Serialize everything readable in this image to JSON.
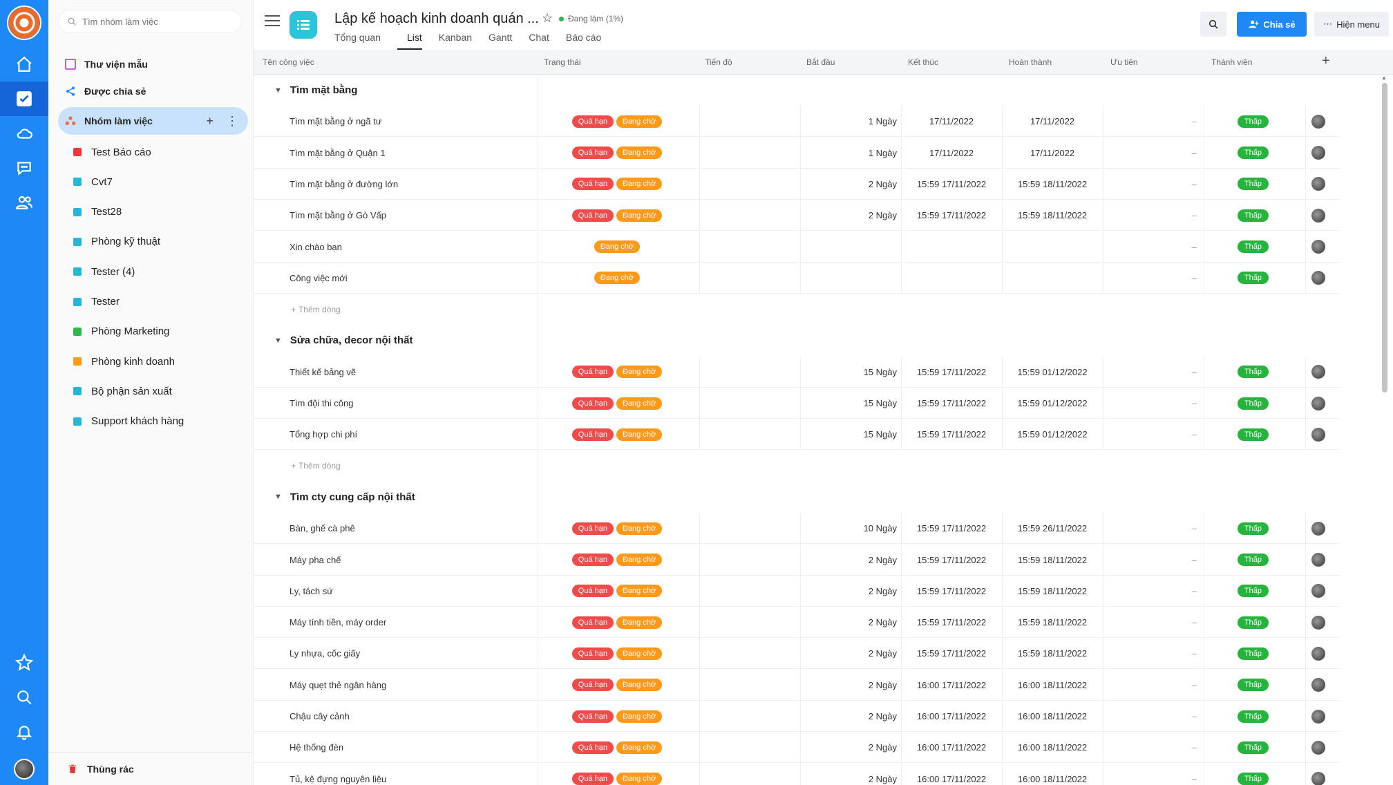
{
  "sidebar": {
    "search_placeholder": "Tìm nhóm làm việc",
    "library": "Thư viện mẫu",
    "shared": "Được chia sẻ",
    "workgroups": "Nhóm làm việc",
    "groups": [
      {
        "label": "Test Báo cáo",
        "color": "#f03a3a"
      },
      {
        "label": "Cvt7",
        "color": "#26b6d8"
      },
      {
        "label": "Test28",
        "color": "#26b6d8"
      },
      {
        "label": "Phòng kỹ thuật",
        "color": "#26b6d8"
      },
      {
        "label": "Tester (4)",
        "color": "#26b6d8"
      },
      {
        "label": "Tester",
        "color": "#26b6d8"
      },
      {
        "label": "Phòng Marketing",
        "color": "#2db84b"
      },
      {
        "label": "Phòng kinh doanh",
        "color": "#fd9a1a"
      },
      {
        "label": "Bộ phận sản xuất",
        "color": "#26b6d8"
      },
      {
        "label": "Support khách hàng",
        "color": "#26b6d8"
      }
    ],
    "trash": "Thùng rác"
  },
  "header": {
    "title": "Lập kế hoạch kinh doanh quán ...",
    "status": "Đang làm (1%)",
    "tabs": [
      "Tổng quan",
      "List",
      "Kanban",
      "Gantt",
      "Chat",
      "Báo cáo"
    ],
    "active_tab": "List",
    "share_label": "Chia sẻ",
    "menu_label": "Hiện menu"
  },
  "columns": [
    "Tên công việc",
    "Trạng thái",
    "Tiến độ",
    "Bắt đầu",
    "Kết thúc",
    "Hoàn thành",
    "Ưu tiên",
    "Thành viên"
  ],
  "add_row_label": "Thêm dòng",
  "groups": [
    {
      "name": "Tìm mặt bằng",
      "tasks": [
        {
          "name": "Tìm mặt bằng ở ngã tư",
          "overdue": "Quá hạn",
          "status": "Đang chờ",
          "duration": "1 Ngày",
          "start": "17/11/2022",
          "end": "17/11/2022",
          "done": "–",
          "priority": "Thấp"
        },
        {
          "name": "Tìm mặt bằng ở Quận 1",
          "overdue": "Quá hạn",
          "status": "Đang chờ",
          "duration": "1 Ngày",
          "start": "17/11/2022",
          "end": "17/11/2022",
          "done": "–",
          "priority": "Thấp"
        },
        {
          "name": "Tìm mặt bằng ở đường lớn",
          "overdue": "Quá hạn",
          "status": "Đang chờ",
          "duration": "2 Ngày",
          "start": "15:59 17/11/2022",
          "end": "15:59 18/11/2022",
          "done": "–",
          "priority": "Thấp"
        },
        {
          "name": "Tìm mặt bằng ở Gò Vấp",
          "overdue": "Quá hạn",
          "status": "Đang chờ",
          "duration": "2 Ngày",
          "start": "15:59 17/11/2022",
          "end": "15:59 18/11/2022",
          "done": "–",
          "priority": "Thấp"
        },
        {
          "name": "Xin chào bạn",
          "overdue": "",
          "status": "Đang chờ",
          "duration": "",
          "start": "",
          "end": "",
          "done": "–",
          "priority": "Thấp"
        },
        {
          "name": "Công việc mới",
          "overdue": "",
          "status": "Đang chờ",
          "duration": "",
          "start": "",
          "end": "",
          "done": "–",
          "priority": "Thấp"
        }
      ]
    },
    {
      "name": "Sửa chữa, decor nội thất",
      "tasks": [
        {
          "name": "Thiết kế bảng vẽ",
          "overdue": "Quá hạn",
          "status": "Đang chờ",
          "duration": "15 Ngày",
          "start": "15:59 17/11/2022",
          "end": "15:59 01/12/2022",
          "done": "–",
          "priority": "Thấp"
        },
        {
          "name": "Tìm đội thi công",
          "overdue": "Quá hạn",
          "status": "Đang chờ",
          "duration": "15 Ngày",
          "start": "15:59 17/11/2022",
          "end": "15:59 01/12/2022",
          "done": "–",
          "priority": "Thấp"
        },
        {
          "name": "Tổng hợp chi phí",
          "overdue": "Quá hạn",
          "status": "Đang chờ",
          "duration": "15 Ngày",
          "start": "15:59 17/11/2022",
          "end": "15:59 01/12/2022",
          "done": "–",
          "priority": "Thấp"
        }
      ]
    },
    {
      "name": "Tìm cty cung cấp nội thất",
      "tasks": [
        {
          "name": "Bàn, ghế cà phê",
          "overdue": "Quá hạn",
          "status": "Đang chờ",
          "duration": "10 Ngày",
          "start": "15:59 17/11/2022",
          "end": "15:59 26/11/2022",
          "done": "–",
          "priority": "Thấp"
        },
        {
          "name": "Máy pha chế",
          "overdue": "Quá hạn",
          "status": "Đang chờ",
          "duration": "2 Ngày",
          "start": "15:59 17/11/2022",
          "end": "15:59 18/11/2022",
          "done": "–",
          "priority": "Thấp"
        },
        {
          "name": "Ly, tách sứ",
          "overdue": "Quá hạn",
          "status": "Đang chờ",
          "duration": "2 Ngày",
          "start": "15:59 17/11/2022",
          "end": "15:59 18/11/2022",
          "done": "–",
          "priority": "Thấp"
        },
        {
          "name": "Máy tính tiền, máy order",
          "overdue": "Quá hạn",
          "status": "Đang chờ",
          "duration": "2 Ngày",
          "start": "15:59 17/11/2022",
          "end": "15:59 18/11/2022",
          "done": "–",
          "priority": "Thấp"
        },
        {
          "name": "Ly nhựa, cốc giấy",
          "overdue": "Quá hạn",
          "status": "Đang chờ",
          "duration": "2 Ngày",
          "start": "15:59 17/11/2022",
          "end": "15:59 18/11/2022",
          "done": "–",
          "priority": "Thấp"
        },
        {
          "name": "Máy quẹt thẻ ngân hàng",
          "overdue": "Quá hạn",
          "status": "Đang chờ",
          "duration": "2 Ngày",
          "start": "16:00 17/11/2022",
          "end": "16:00 18/11/2022",
          "done": "–",
          "priority": "Thấp"
        },
        {
          "name": "Chậu cây cảnh",
          "overdue": "Quá hạn",
          "status": "Đang chờ",
          "duration": "2 Ngày",
          "start": "16:00 17/11/2022",
          "end": "16:00 18/11/2022",
          "done": "–",
          "priority": "Thấp"
        },
        {
          "name": "Hệ thống đèn",
          "overdue": "Quá hạn",
          "status": "Đang chờ",
          "duration": "2 Ngày",
          "start": "16:00 17/11/2022",
          "end": "16:00 18/11/2022",
          "done": "–",
          "priority": "Thấp"
        },
        {
          "name": "Tủ, kệ đựng nguyên liệu",
          "overdue": "Quá hạn",
          "status": "Đang chờ",
          "duration": "2 Ngày",
          "start": "16:00 17/11/2022",
          "end": "16:00 18/11/2022",
          "done": "–",
          "priority": "Thấp"
        }
      ]
    }
  ]
}
